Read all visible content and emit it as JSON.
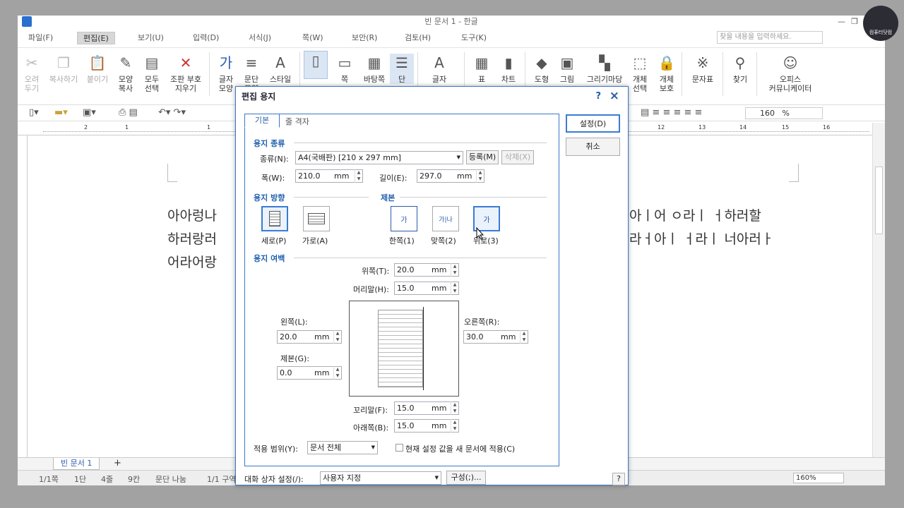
{
  "window": {
    "title": "빈 문서 1 - 한글",
    "search_placeholder": "찾을 내용을 입력하세요.",
    "logo_text": "컴퓨터닷컴"
  },
  "menu": [
    "파일(F)",
    "편집(E)",
    "보기(U)",
    "입력(D)",
    "서식(J)",
    "쪽(W)",
    "보안(R)",
    "검토(H)",
    "도구(K)"
  ],
  "ribbon": {
    "cut": "오려\n두기",
    "copy": "복사하기",
    "paste": "붙이기",
    "format_copy": "모양\n복사",
    "select_all": "모두\n선택",
    "clear_marks": "조판 부호\n지우기",
    "char_shape": "글자\n모양",
    "para_shape": "문단\n모양",
    "style": "스타일",
    "page": "쪽",
    "background": "바탕쪽",
    "column": "단",
    "char": "글자",
    "table": "표",
    "chart": "차트",
    "shape": "도형",
    "picture": "그림",
    "gallery": "그리기마당",
    "obj_select": "개체\n선택",
    "obj_protect": "개체\n보호",
    "char_map": "문자표",
    "find": "찾기",
    "office": "오피스\n커뮤니케이터"
  },
  "toolbar": {
    "zoom": "160",
    "zoom_unit": "%"
  },
  "ruler_ticks": [
    "2",
    "1",
    "1",
    "12",
    "13",
    "14",
    "15",
    "16"
  ],
  "doc_lines": {
    "l1a": "아아렁나 ",
    "l1b": "아ㅣ어 ㅇ라ㅣ ㅓ하러할",
    "l2a": "하러랑러",
    "l2b": "라ㅓ아ㅣ ㅓ라ㅣ 너아러ㅏ",
    "l3": "어라어랑"
  },
  "tabs": {
    "doc_tab": "빈 문서 1",
    "add": "+"
  },
  "status": {
    "page": "1/1쪽",
    "section": "1단",
    "line": "4줄",
    "col": "9칸",
    "break": "문단 나눔",
    "sect": "1/1 구역",
    "zoom": "160%"
  },
  "dialog": {
    "title": "편집 용지",
    "tab_basic": "기본",
    "tab_grid": "줄 격자",
    "ok": "설정(D)",
    "cancel": "취소",
    "paper_type_group": "용지 종류",
    "type_label": "종류(N):",
    "type_value": "A4(국배판) [210 x 297 mm]",
    "register": "등록(M)",
    "delete": "삭제(X)",
    "width_label": "폭(W):",
    "width_value": "210.0",
    "height_label": "길이(E):",
    "height_value": "297.0",
    "unit": "mm",
    "orientation_group": "용지 방향",
    "binding_group": "제본",
    "portrait": "세로(P)",
    "landscape": "가로(A)",
    "one_side": "한쪽(1)",
    "facing": "맞쪽(2)",
    "top_bind": "위로(3)",
    "margin_group": "용지 여백",
    "top_label": "위쪽(T):",
    "top_value": "20.0",
    "header_label": "머리말(H):",
    "header_value": "15.0",
    "left_label": "왼쪽(L):",
    "left_value": "20.0",
    "right_label": "오른쪽(R):",
    "right_value": "30.0",
    "gutter_label": "제본(G):",
    "gutter_value": "0.0",
    "footer_label": "꼬리말(F):",
    "footer_value": "15.0",
    "bottom_label": "아래쪽(B):",
    "bottom_value": "15.0",
    "apply_label": "적용 범위(Y):",
    "apply_value": "문서 전체",
    "apply_new": "현재 설정 값을 새 문서에 적용(C)",
    "dlg_setting_label": "대화 상자 설정(/):",
    "dlg_setting_value": "사용자 지정",
    "compose": "구성(;)...",
    "help": "?",
    "close": "×"
  },
  "colors": {
    "accent": "#3a7bd5",
    "group": "#1f5fb0"
  }
}
